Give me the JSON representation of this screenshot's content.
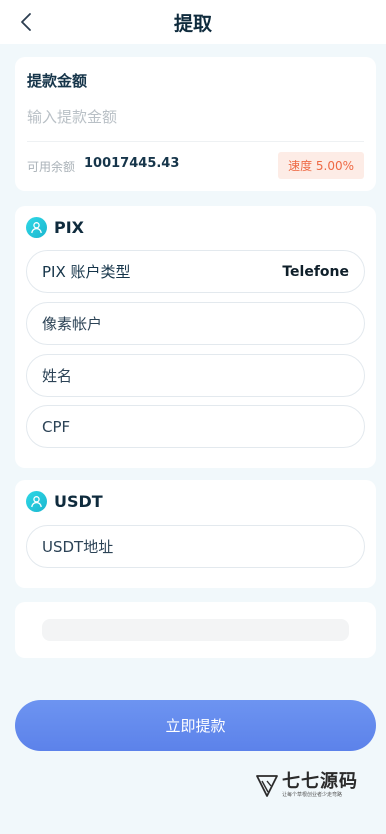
{
  "header": {
    "title": "提取",
    "back_icon": "chevron-left-icon"
  },
  "amount_card": {
    "label": "提款金额",
    "placeholder": "输入提款金额",
    "balance_label": "可用余额",
    "balance_value": "10017445.43",
    "rate_text": "速度 5.00%",
    "rate_color": "#ee6a45"
  },
  "pix": {
    "icon": "user-avatar-icon",
    "title": "PIX",
    "account_type_label": "PIX 账户类型",
    "account_type_value": "Telefone",
    "pixel_account_placeholder": "像素帐户",
    "name_placeholder": "姓名",
    "cpf_placeholder": "CPF"
  },
  "usdt": {
    "icon": "user-avatar-icon",
    "title": "USDT",
    "address_placeholder": "USDT地址"
  },
  "submit": {
    "label": "立即提款",
    "color": "#6489ee"
  },
  "watermark": {
    "name": "七七源码",
    "slogan": "让每个草根创业者少走弯路"
  }
}
